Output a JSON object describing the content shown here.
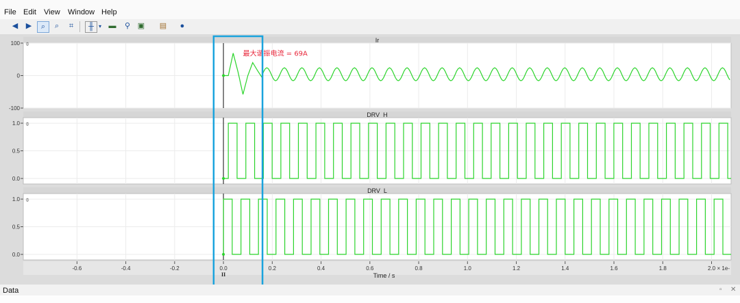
{
  "menu": [
    "File",
    "Edit",
    "View",
    "Window",
    "Help"
  ],
  "toolbar": {
    "icons": [
      "back-icon",
      "forward-icon",
      "zoom-in-icon",
      "zoom-out-icon",
      "zoom-fit-icon",
      "cursor-icon",
      "cursor-dropdown-icon",
      "waveform-icon",
      "analysis-icon",
      "export-icon",
      "window-icon",
      "help-icon"
    ]
  },
  "colors": {
    "trace": "#2bd42b",
    "annotation": "#e8283c",
    "highlight": "#1aa3dd",
    "panel_title_bar": "#d6d6d6",
    "plot_bg": "#ffffff"
  },
  "chart_data": [
    {
      "type": "line",
      "title": "Ir",
      "ylim": [
        -100,
        100
      ],
      "yticks": [
        "100",
        "0",
        "-100"
      ],
      "annotation": "最大谐振电流 = 69A",
      "series": [
        {
          "color": "#2bd42b",
          "x": [
            0.0,
            0.02,
            0.04,
            0.06,
            0.08,
            0.1,
            0.12,
            0.14,
            0.16
          ],
          "y": [
            0,
            0,
            69,
            10,
            -58,
            0,
            40,
            15,
            -8
          ]
        }
      ],
      "steady_state": {
        "start": 0.16,
        "period": 0.0718,
        "amplitude": 20,
        "baseline": 4
      }
    },
    {
      "type": "line",
      "title": "DRV_H",
      "ylim": [
        -0.1,
        1.1
      ],
      "yticks": [
        "1.0",
        "0.5",
        "0.0"
      ],
      "series": [
        {
          "color": "#2bd42b",
          "waveform": "square",
          "start": 0.02,
          "period": 0.0718,
          "duty": 0.5,
          "low": 0.0,
          "high": 1.0
        }
      ]
    },
    {
      "type": "line",
      "title": "DRV_L",
      "ylim": [
        -0.1,
        1.1
      ],
      "yticks": [
        "1.0",
        "0.5",
        "0.0"
      ],
      "series": [
        {
          "color": "#2bd42b",
          "waveform": "square",
          "start": 0.0,
          "period": 0.0718,
          "duty": 0.5,
          "low": 0.0,
          "high": 1.0
        }
      ]
    }
  ],
  "x_axis": {
    "label": "Time / s",
    "xlim": [
      -0.82,
      2.08
    ],
    "ticks": [
      "-0.6",
      "-0.4",
      "-0.2",
      "0.0",
      "0.2",
      "0.4",
      "0.6",
      "0.8",
      "1.0",
      "1.2",
      "1.4",
      "1.6",
      "1.8",
      "2.0"
    ],
    "scale_label": "× 1e-",
    "cursor_label": "II"
  },
  "highlight_box": {
    "x_start": -0.04,
    "x_end": 0.16
  },
  "bottom_panel": {
    "label": "Data"
  }
}
